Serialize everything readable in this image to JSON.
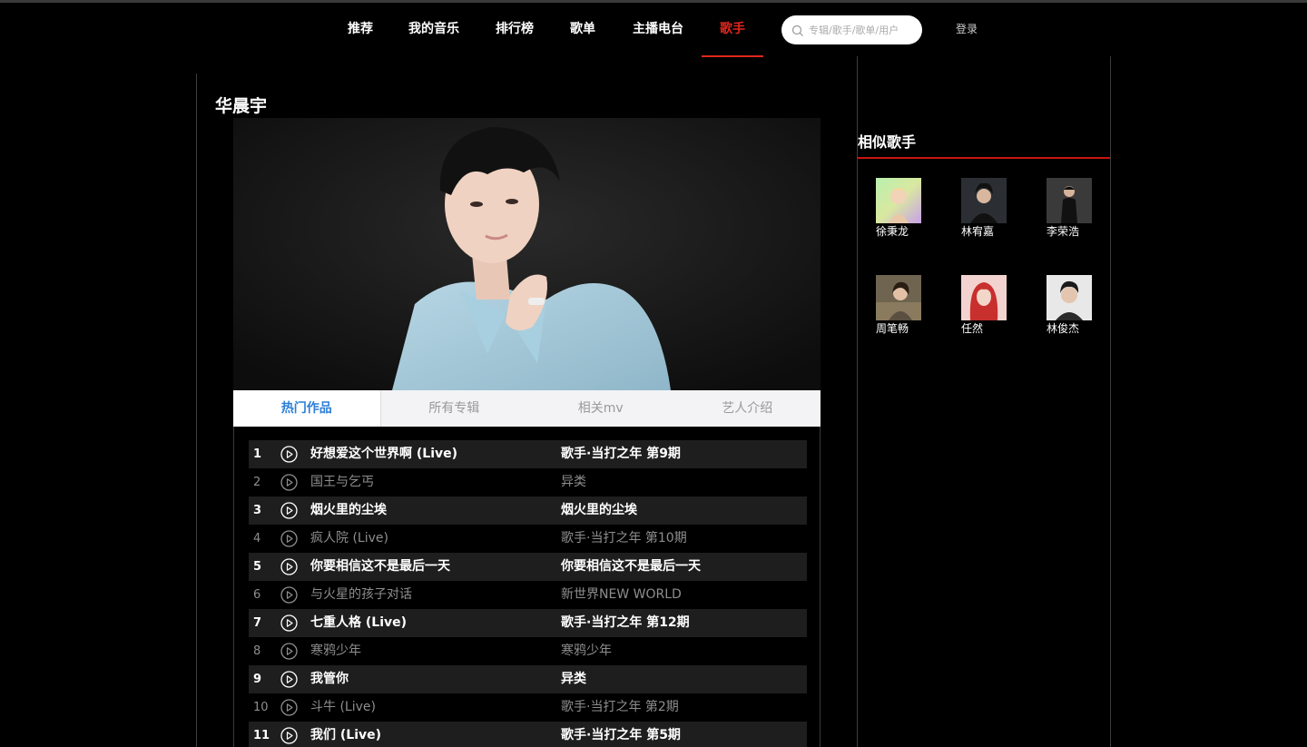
{
  "nav": {
    "items": [
      {
        "label": "推荐"
      },
      {
        "label": "我的音乐"
      },
      {
        "label": "排行榜"
      },
      {
        "label": "歌单"
      },
      {
        "label": "主播电台"
      },
      {
        "label": "歌手"
      }
    ],
    "active_index": 5,
    "search_placeholder": "专辑/歌手/歌单/用户",
    "login_label": "登录"
  },
  "artist": {
    "name": "华晨宇"
  },
  "tabs": [
    {
      "label": "热门作品",
      "active": true
    },
    {
      "label": "所有专辑",
      "active": false
    },
    {
      "label": "相关mv",
      "active": false
    },
    {
      "label": "艺人介绍",
      "active": false
    }
  ],
  "tracks": [
    {
      "num": "1",
      "song": "好想爱这个世界啊 (Live)",
      "album": "歌手·当打之年 第9期"
    },
    {
      "num": "2",
      "song": "国王与乞丐",
      "album": "异类"
    },
    {
      "num": "3",
      "song": "烟火里的尘埃",
      "album": "烟火里的尘埃"
    },
    {
      "num": "4",
      "song": "疯人院 (Live)",
      "album": "歌手·当打之年 第10期"
    },
    {
      "num": "5",
      "song": "你要相信这不是最后一天",
      "album": "你要相信这不是最后一天"
    },
    {
      "num": "6",
      "song": "与火星的孩子对话",
      "album": "新世界NEW WORLD"
    },
    {
      "num": "7",
      "song": "七重人格 (Live)",
      "album": "歌手·当打之年 第12期"
    },
    {
      "num": "8",
      "song": "寒鸦少年",
      "album": "寒鸦少年"
    },
    {
      "num": "9",
      "song": "我管你",
      "album": "异类"
    },
    {
      "num": "10",
      "song": "斗牛 (Live)",
      "album": "歌手·当打之年 第2期"
    },
    {
      "num": "11",
      "song": "我们 (Live)",
      "album": "歌手·当打之年 第5期"
    }
  ],
  "sidebar": {
    "title": "相似歌手",
    "artists": [
      {
        "name": "徐秉龙"
      },
      {
        "name": "林宥嘉"
      },
      {
        "name": "李荣浩"
      },
      {
        "name": "周笔畅"
      },
      {
        "name": "任然"
      },
      {
        "name": "林俊杰"
      }
    ]
  },
  "colors": {
    "accent_red": "#e0261c",
    "tab_active_blue": "#2b7ed8",
    "background": "#000000",
    "row_stripe": "#1e1e1e"
  }
}
